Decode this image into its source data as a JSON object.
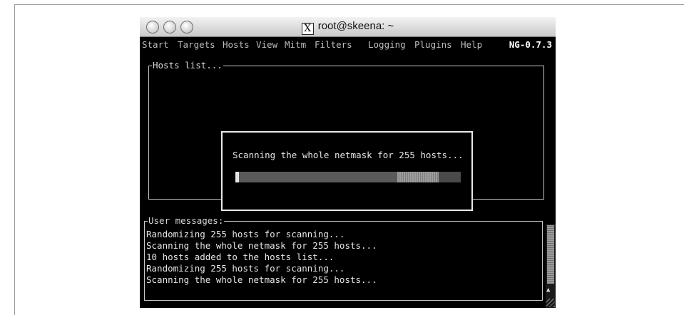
{
  "window": {
    "title": "root@skeena: ~",
    "title_icon": "x11-icon",
    "title_icon_glyph": "X"
  },
  "menubar": {
    "items": [
      "Start",
      "Targets",
      "Hosts",
      "View",
      "Mitm",
      "Filters",
      "Logging",
      "Plugins",
      "Help"
    ],
    "version": "NG-0.7.3"
  },
  "hosts_panel": {
    "label": "Hosts list..."
  },
  "scan_dialog": {
    "message": "Scanning the whole netmask for 255 hosts...",
    "progress": 0.81
  },
  "user_messages": {
    "label": "User messages:",
    "lines": [
      "Randomizing 255 hosts for scanning...",
      "Scanning the whole netmask for 255 hosts...",
      "10 hosts added to the hosts list...",
      "Randomizing 255 hosts for scanning...",
      "Scanning the whole netmask for 255 hosts..."
    ]
  },
  "scrollbar": {
    "down_arrow": "▲"
  },
  "colors": {
    "terminal_bg": "#000000",
    "terminal_fg": "#e6e6e6",
    "titlebar": "#dcdcdc"
  }
}
